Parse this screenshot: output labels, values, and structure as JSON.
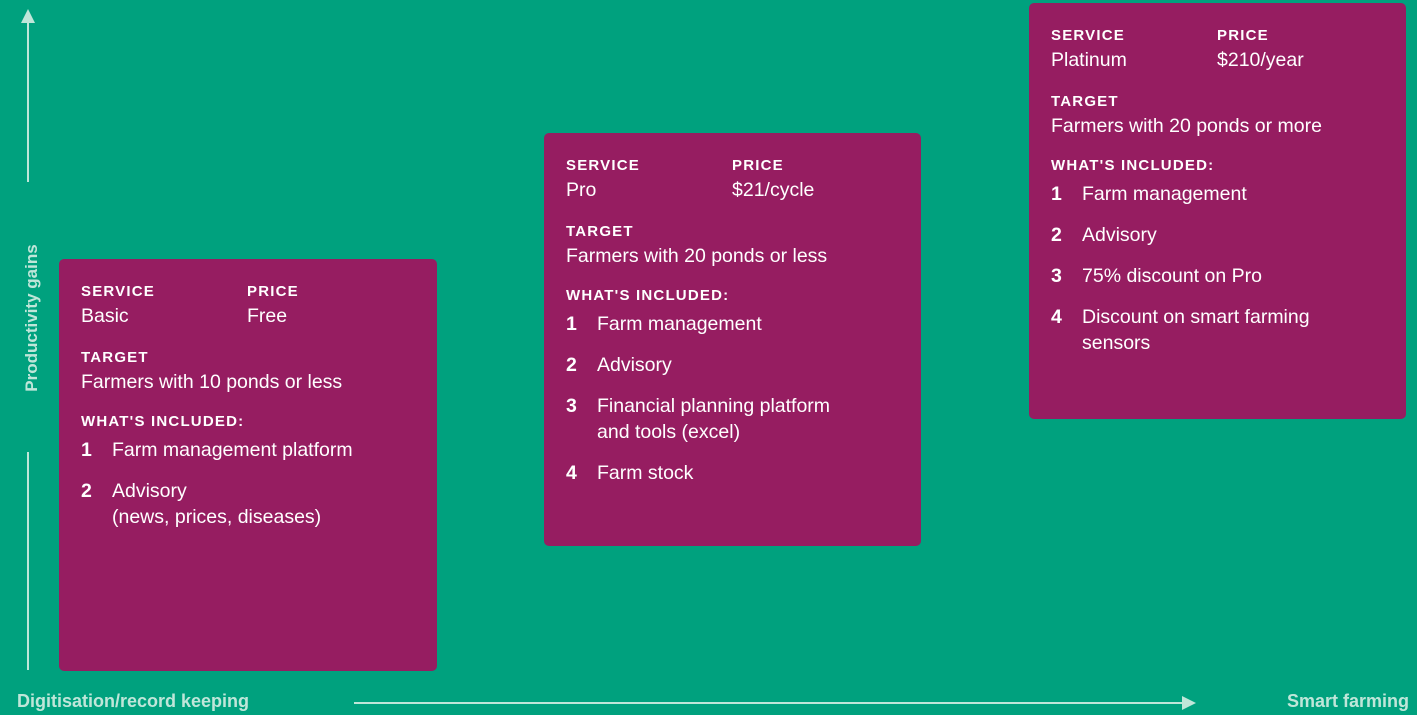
{
  "axes": {
    "y_label": "Productivity gains",
    "x_label_left": "Digitisation/record keeping",
    "x_label_right": "Smart farming"
  },
  "labels": {
    "service": "SERVICE",
    "price": "PRICE",
    "target": "TARGET",
    "included": "WHAT'S INCLUDED:"
  },
  "tiers": [
    {
      "service": "Basic",
      "price": "Free",
      "target": "Farmers with 10 ponds or less",
      "items": [
        {
          "num": "1",
          "lines": [
            "Farm management platform"
          ]
        },
        {
          "num": "2",
          "lines": [
            "Advisory",
            "(news, prices, diseases)"
          ]
        }
      ]
    },
    {
      "service": "Pro",
      "price": "$21/cycle",
      "target": "Farmers with 20 ponds or less",
      "items": [
        {
          "num": "1",
          "lines": [
            "Farm management"
          ]
        },
        {
          "num": "2",
          "lines": [
            "Advisory"
          ]
        },
        {
          "num": "3",
          "lines": [
            "Financial planning platform",
            "and tools (excel)"
          ]
        },
        {
          "num": "4",
          "lines": [
            "Farm stock"
          ]
        }
      ]
    },
    {
      "service": "Platinum",
      "price": "$210/year",
      "target": "Farmers with 20 ponds or more",
      "items": [
        {
          "num": "1",
          "lines": [
            "Farm management"
          ]
        },
        {
          "num": "2",
          "lines": [
            "Advisory"
          ]
        },
        {
          "num": "3",
          "lines": [
            "75% discount on Pro"
          ]
        },
        {
          "num": "4",
          "lines": [
            "Discount on smart farming",
            "sensors"
          ]
        }
      ]
    }
  ],
  "colors": {
    "background": "#00a17e",
    "card": "#961d61",
    "axis": "#bfe6d9",
    "text": "#ffffff"
  }
}
